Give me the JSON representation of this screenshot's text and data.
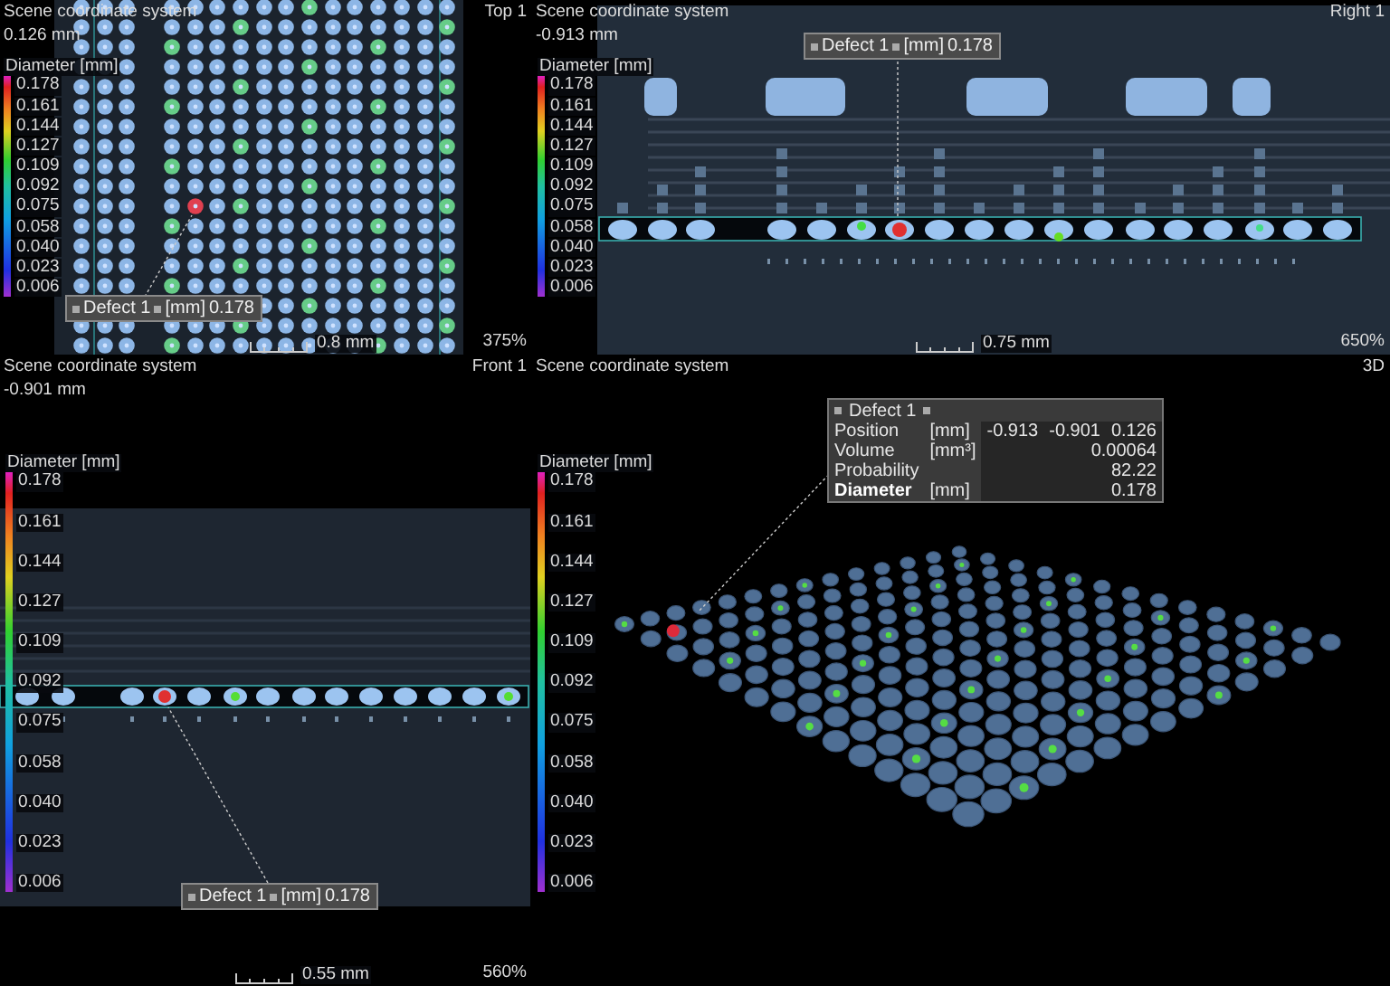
{
  "panes": [
    {
      "kind": "top",
      "view": "Top 1",
      "coordinate_system": "Scene coordinate system",
      "offset": "0.126 mm",
      "legend": {
        "title": "Diameter [mm]",
        "ticks": [
          "0.178",
          "0.161",
          "0.144",
          "0.127",
          "0.109",
          "0.092",
          "0.075",
          "0.058",
          "0.040",
          "0.023",
          "0.006"
        ]
      },
      "defect_label": {
        "name": "Defect 1",
        "unit": "[mm]",
        "value": "0.178"
      },
      "scale": "0.8 mm",
      "zoom": "375%"
    },
    {
      "kind": "right",
      "view": "Right 1",
      "coordinate_system": "Scene coordinate system",
      "offset": "-0.913 mm",
      "legend": {
        "title": "Diameter [mm]",
        "ticks": [
          "0.178",
          "0.161",
          "0.144",
          "0.127",
          "0.109",
          "0.092",
          "0.075",
          "0.058",
          "0.040",
          "0.023",
          "0.006"
        ]
      },
      "defect_label": {
        "name": "Defect 1",
        "unit": "[mm]",
        "value": "0.178"
      },
      "scale": "0.75 mm",
      "zoom": "650%"
    },
    {
      "kind": "front",
      "view": "Front 1",
      "coordinate_system": "Scene coordinate system",
      "offset": "-0.901 mm",
      "legend": {
        "title": "Diameter [mm]",
        "ticks": [
          "0.178",
          "0.161",
          "0.144",
          "0.127",
          "0.109",
          "0.092",
          "0.075",
          "0.058",
          "0.040",
          "0.023",
          "0.006"
        ]
      },
      "defect_label": {
        "name": "Defect 1",
        "unit": "[mm]",
        "value": "0.178"
      },
      "scale": "0.55 mm",
      "zoom": "560%"
    },
    {
      "kind": "perspective",
      "view": "3D",
      "coordinate_system": "Scene coordinate system",
      "legend": {
        "title": "Diameter [mm]",
        "ticks": [
          "0.178",
          "0.161",
          "0.144",
          "0.127",
          "0.109",
          "0.092",
          "0.075",
          "0.058",
          "0.040",
          "0.023",
          "0.006"
        ]
      },
      "defect_info": {
        "title": "Defect 1",
        "rows": [
          {
            "label": "Position",
            "unit": "[mm]",
            "values": [
              "-0.913",
              "-0.901",
              "0.126"
            ],
            "emphasized": false
          },
          {
            "label": "Volume",
            "unit": "[mm³]",
            "values": [
              "0.00064"
            ],
            "emphasized": false
          },
          {
            "label": "Probability",
            "values": [
              "82.22"
            ],
            "emphasized": false
          },
          {
            "label": "Diameter",
            "unit": "[mm]",
            "values": [
              "0.178"
            ],
            "emphasized": true
          }
        ]
      }
    }
  ]
}
